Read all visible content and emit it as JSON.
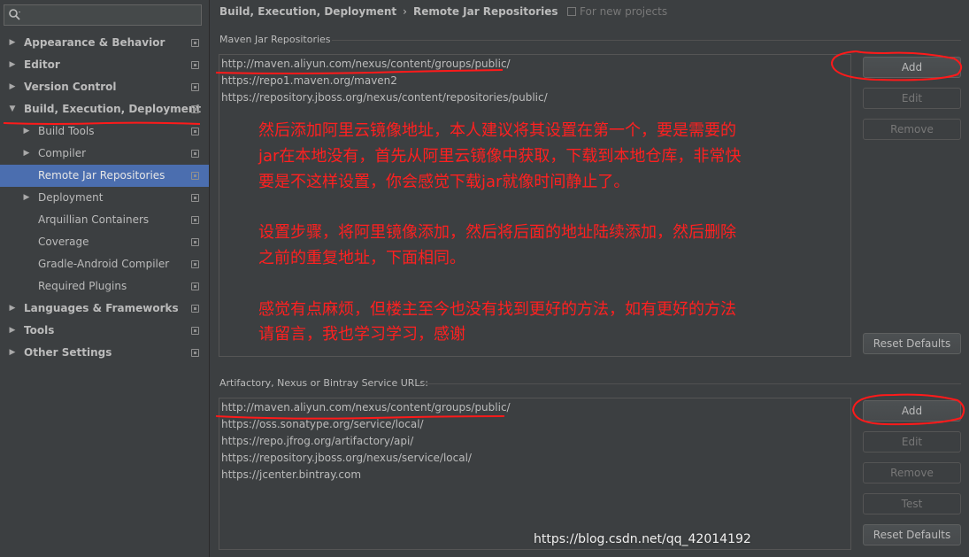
{
  "sidebar": {
    "search": {
      "value": "",
      "placeholder": ""
    },
    "items": [
      {
        "label": "Appearance & Behavior",
        "bold": true,
        "arrow": "▶",
        "level": 0
      },
      {
        "label": "Editor",
        "bold": true,
        "arrow": "▶",
        "level": 0
      },
      {
        "label": "Version Control",
        "bold": true,
        "arrow": "▶",
        "level": 0
      },
      {
        "label": "Build, Execution, Deployment",
        "bold": true,
        "arrow": "▼",
        "level": 0
      },
      {
        "label": "Build Tools",
        "bold": false,
        "arrow": "▶",
        "level": 1
      },
      {
        "label": "Compiler",
        "bold": false,
        "arrow": "▶",
        "level": 1
      },
      {
        "label": "Remote Jar Repositories",
        "bold": false,
        "arrow": "",
        "level": 1,
        "selected": true
      },
      {
        "label": "Deployment",
        "bold": false,
        "arrow": "▶",
        "level": 1
      },
      {
        "label": "Arquillian Containers",
        "bold": false,
        "arrow": "",
        "level": 1
      },
      {
        "label": "Coverage",
        "bold": false,
        "arrow": "",
        "level": 1
      },
      {
        "label": "Gradle-Android Compiler",
        "bold": false,
        "arrow": "",
        "level": 1
      },
      {
        "label": "Required Plugins",
        "bold": false,
        "arrow": "",
        "level": 1
      },
      {
        "label": "Languages & Frameworks",
        "bold": true,
        "arrow": "▶",
        "level": 0
      },
      {
        "label": "Tools",
        "bold": true,
        "arrow": "▶",
        "level": 0
      },
      {
        "label": "Other Settings",
        "bold": true,
        "arrow": "▶",
        "level": 0
      }
    ]
  },
  "header": {
    "breadcrumb_parent": "Build, Execution, Deployment",
    "breadcrumb_sep": "›",
    "breadcrumb_current": "Remote Jar Repositories",
    "scope_note": "For new projects"
  },
  "maven": {
    "title": "Maven Jar Repositories",
    "urls": [
      "http://maven.aliyun.com/nexus/content/groups/public/",
      "https://repo1.maven.org/maven2",
      "https://repository.jboss.org/nexus/content/repositories/public/"
    ],
    "buttons": {
      "add": "Add",
      "edit": "Edit",
      "remove": "Remove",
      "reset": "Reset Defaults"
    }
  },
  "service": {
    "title": "Artifactory, Nexus or Bintray Service URLs:",
    "urls": [
      "http://maven.aliyun.com/nexus/content/groups/public/",
      "https://oss.sonatype.org/service/local/",
      "https://repo.jfrog.org/artifactory/api/",
      "https://repository.jboss.org/nexus/service/local/",
      "https://jcenter.bintray.com"
    ],
    "buttons": {
      "add": "Add",
      "edit": "Edit",
      "remove": "Remove",
      "test": "Test",
      "reset": "Reset Defaults"
    }
  },
  "annotation": {
    "lines": [
      "然后添加阿里云镜像地址，本人建议将其设置在第一个，要是需要的",
      "jar在本地没有，首先从阿里云镜像中获取，下载到本地仓库，非常快",
      "要是不这样设置，你会感觉下载jar就像时间静止了。",
      "",
      "设置步骤，将阿里镜像添加，然后将后面的地址陆续添加，然后删除",
      "之前的重复地址，下面相同。",
      "",
      "感觉有点麻烦，但楼主至今也没有找到更好的方法，如有更好的方法",
      "请留言，我也学习学习，感谢"
    ],
    "color": "#ff2020"
  },
  "watermark": "https://blog.csdn.net/qq_42014192",
  "colors": {
    "selection": "#4b6eaf",
    "background": "#3c3f41",
    "annotation": "#ff2020"
  }
}
